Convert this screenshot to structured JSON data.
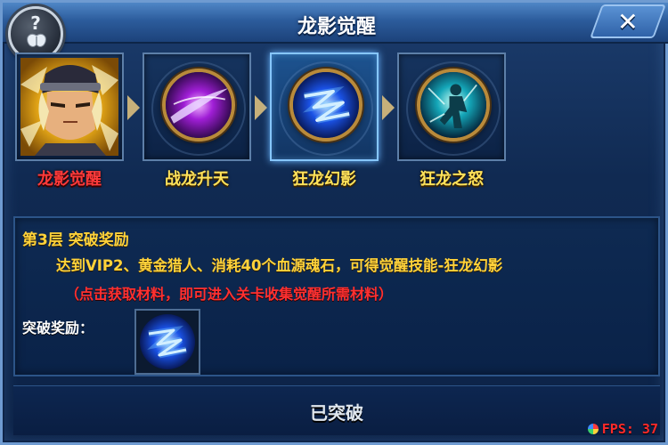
{
  "window": {
    "title": "龙影觉醒",
    "help_icon": "question-wing-icon",
    "close_label": "✕"
  },
  "skills": [
    {
      "label": "龙影觉醒",
      "icon": "hero-portrait",
      "state": "active"
    },
    {
      "label": "战龙升天",
      "icon": "purple-slash-orb"
    },
    {
      "label": "狂龙幻影",
      "icon": "blue-lightning-orb",
      "state": "selected"
    },
    {
      "label": "狂龙之怒",
      "icon": "cyan-warrior-orb"
    }
  ],
  "breakthrough": {
    "tier_title": "第3层 突破奖励",
    "requirement": "达到VIP2、黄金猎人、消耗40个血源魂石，可得觉醒技能-狂龙幻影",
    "hint": "（点击获取材料，即可进入关卡收集觉醒所需材料）",
    "reward_label": "突破奖励：",
    "reward_icon": "blue-lightning-orb"
  },
  "status": {
    "text": "已突破"
  },
  "fps": {
    "label": "FPS: 37"
  },
  "colors": {
    "active_label": "#ff3a3a",
    "skill_label": "#ffe25a",
    "hint": "#ff3030"
  }
}
